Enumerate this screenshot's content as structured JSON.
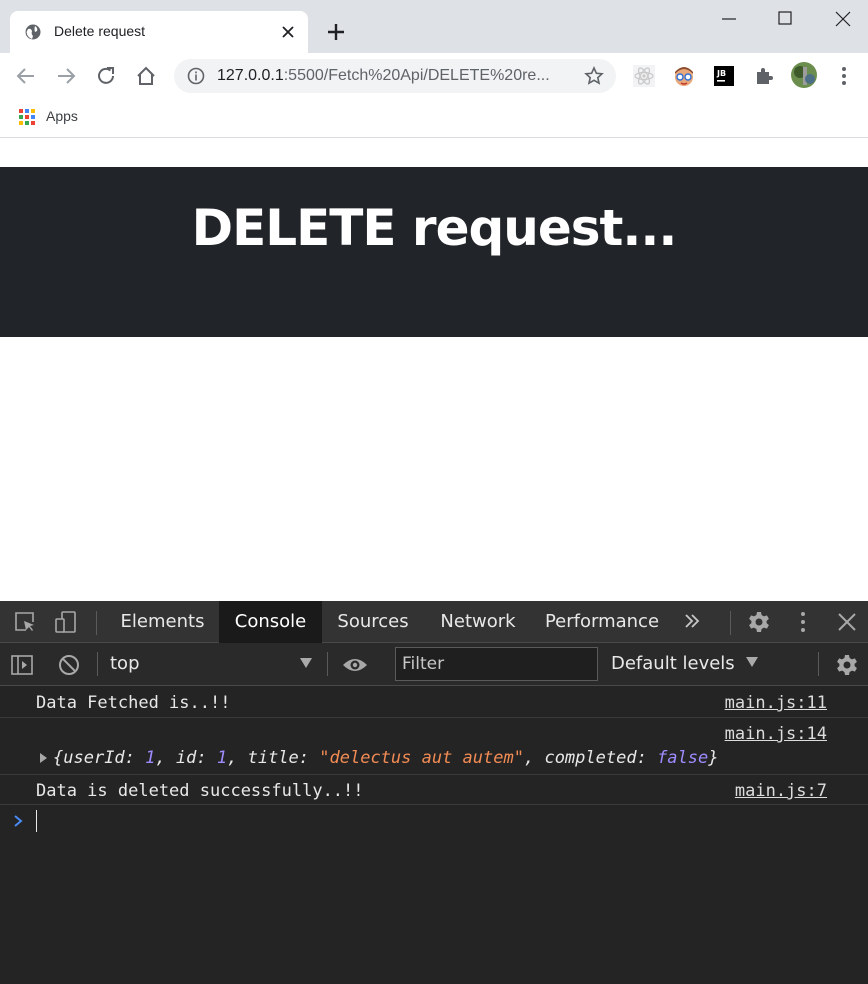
{
  "browser": {
    "tab_title": "Delete request",
    "url_host": "127.0.0.1",
    "url_rest": ":5500/Fetch%20Api/DELETE%20re...",
    "bookmarks": {
      "apps_label": "Apps"
    }
  },
  "page": {
    "heading": "DELETE request..."
  },
  "devtools": {
    "tabs": [
      "Elements",
      "Console",
      "Sources",
      "Network",
      "Performance"
    ],
    "active_tab": "Console",
    "context": "top",
    "filter_placeholder": "Filter",
    "levels_label": "Default levels",
    "messages": [
      {
        "text": "Data Fetched is..!!",
        "source": "main.js:11"
      },
      {
        "source": "main.js:14",
        "object": {
          "userId_key": "userId:",
          "userId_val": "1",
          "id_key": "id:",
          "id_val": "1",
          "title_key": "title:",
          "title_val": "\"delectus aut autem\"",
          "completed_key": "completed:",
          "completed_val": "false"
        }
      },
      {
        "text": "Data is deleted successfully..!!",
        "source": "main.js:7"
      }
    ]
  },
  "colors": {
    "hero_bg": "#212529",
    "devtools_bg": "#242424",
    "console_string": "#f28b54",
    "console_number": "#9e8bff"
  }
}
